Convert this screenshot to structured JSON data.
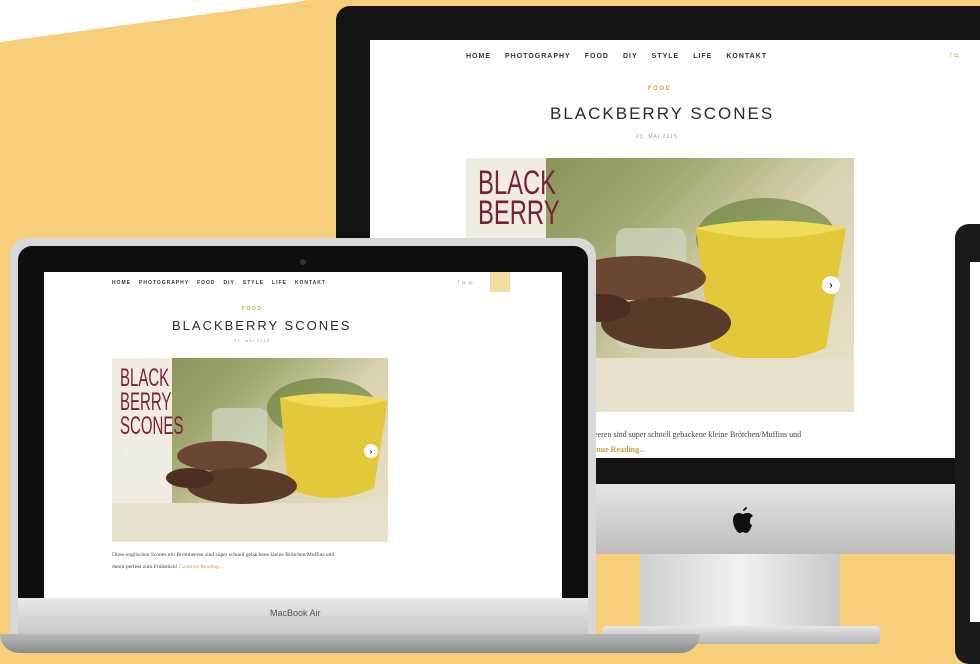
{
  "imac": {
    "nav": [
      "HOME",
      "PHOTOGRAPHY",
      "FOOD",
      "DIY",
      "STYLE",
      "LIFE",
      "KONTAKT"
    ],
    "category": "FOOD",
    "title": "BLACKBERRY SCONES",
    "date": "23. MAI 2015",
    "hero_text_lines": [
      "BLACK",
      "BERRY"
    ],
    "body": "beeren sind super schnell gebackene kleine Brötchen/Muffins und",
    "more": "inue Reading..."
  },
  "macbook": {
    "nav": [
      "HOME",
      "PHOTOGRAPHY",
      "FOOD",
      "DIY",
      "STYLE",
      "LIFE",
      "KONTAKT"
    ],
    "category": "FOOD",
    "title": "BLACKBERRY SCONES",
    "date": "23. MAI 2015",
    "hero_text_lines": [
      "BLACK",
      "BERRY",
      "SCONES"
    ],
    "body_line1": "Diese englischen Scones mit Brombeeren sind super schnell gebackene kleine Brötchen/Muffins und",
    "body_line2": "damit perfekt zum Frühstück!",
    "more": "Continue Reading...",
    "label": "MacBook Air"
  },
  "icons": [
    "facebook-icon",
    "instagram-icon",
    "pinterest-icon",
    "search-icon",
    "apple-logo-icon",
    "chevron-left-icon",
    "chevron-right-icon"
  ],
  "colors": {
    "background": "#f7cf7a",
    "accent": "#c9a14a"
  }
}
